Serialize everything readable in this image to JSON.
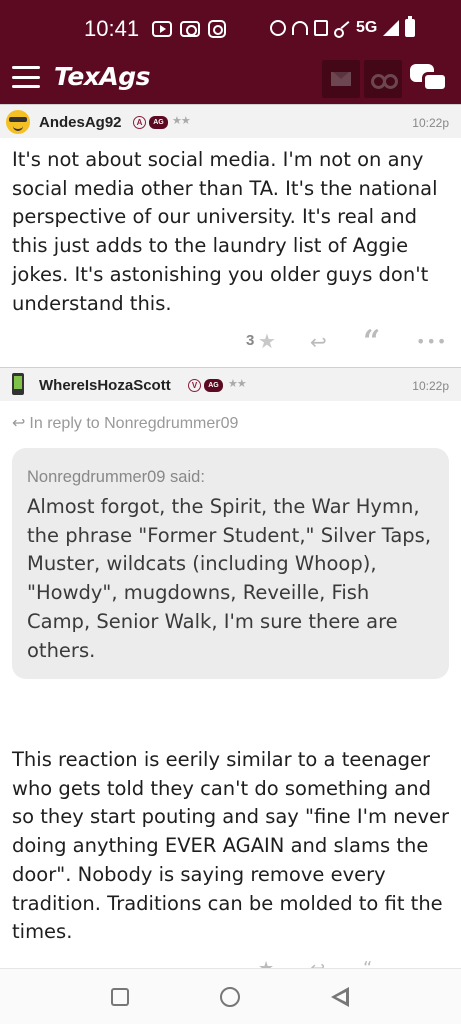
{
  "status_bar": {
    "time": "10:41",
    "network": "5G",
    "left_icons": [
      "youtube-icon",
      "camera-icon",
      "instagram-icon"
    ],
    "right_icons": [
      "alarm-icon",
      "headset-icon",
      "nfc-icon",
      "key-icon",
      "signal-icon",
      "battery-icon"
    ]
  },
  "app_bar": {
    "brand": "TexAgs",
    "background": "#5c0a22",
    "icons": [
      "menu-icon",
      "mail-icon",
      "binoculars-icon",
      "chat-icon"
    ]
  },
  "posts": [
    {
      "username": "AndesAg92",
      "badge_letter": "A",
      "badge_ag": "AG",
      "stars": "★★",
      "timestamp": "10:22p",
      "avatar": "sunglasses-smiley-icon",
      "body": "It's not about social media. I'm not on any social media other than TA. It's the national perspective of our university. It's real and this just adds to the laundry list of Aggie jokes. It's astonishing you older guys don't understand this.",
      "star_count": "3"
    },
    {
      "username": "WhereIsHozaScott",
      "badge_letter": "V",
      "badge_ag": "AG",
      "stars": "★★",
      "timestamp": "10:22p",
      "avatar": "phone-icon",
      "reply_to": "In reply to Nonregdrummer09",
      "quote_author": "Nonregdrummer09 said:",
      "quote_text": "Almost forgot, the Spirit, the War Hymn, the phrase \"Former Student,\" Silver Taps, Muster, wildcats (including Whoop), \"Howdy\", mugdowns, Reveille, Fish Camp, Senior Walk, I'm sure there are others.",
      "body": "This reaction is eerily similar to a teenager who gets told they can't do something and so they start pouting and say \"fine I'm never doing anything EVER AGAIN and slams the door\". Nobody is saying remove every tradition. Traditions can be molded to fit the times."
    }
  ],
  "nav_bar": {
    "icons": [
      "recents-icon",
      "home-icon",
      "back-icon"
    ]
  }
}
